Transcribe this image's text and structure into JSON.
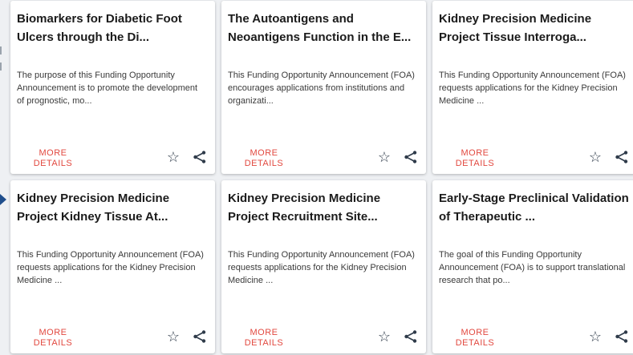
{
  "cards": [
    {
      "title": "Biomarkers for Diabetic Foot Ulcers through the Di...",
      "description": "The purpose of this Funding Opportunity Announcement is to promote the development of prognostic, mo...",
      "more_label": "MORE DETAILS"
    },
    {
      "title": "The Autoantigens and Neoantigens Function in the E...",
      "description": "This Funding Opportunity Announcement (FOA) encourages applications from institutions and organizati...",
      "more_label": "MORE DETAILS"
    },
    {
      "title": "Kidney Precision Medicine Project Tissue Interroga...",
      "description": "This Funding Opportunity Announcement (FOA) requests applications for the Kidney Precision Medicine ...",
      "more_label": "MORE DETAILS"
    },
    {
      "title": "Kidney Precision Medicine Project Kidney Tissue At...",
      "description": "This Funding Opportunity Announcement (FOA) requests applications for the Kidney Precision Medicine ...",
      "more_label": "MORE DETAILS"
    },
    {
      "title": "Kidney Precision Medicine Project Recruitment Site...",
      "description": "This Funding Opportunity Announcement (FOA) requests applications for the Kidney Precision Medicine ...",
      "more_label": "MORE DETAILS"
    },
    {
      "title": "Early-Stage Preclinical Validation of Therapeutic ...",
      "description": "The goal of this Funding Opportunity Announcement (FOA) is to support translational research that po...",
      "more_label": "MORE DETAILS"
    }
  ],
  "icons": {
    "favorite": "star-outline-icon",
    "share": "share-icon",
    "carousel_arrow": "carousel-arrow-icon"
  },
  "colors": {
    "accent": "#e2483f",
    "title": "#1b1b1b",
    "icon": "#2f3b4a",
    "arrow": "#1f4e8c",
    "background": "#eef0f3"
  }
}
